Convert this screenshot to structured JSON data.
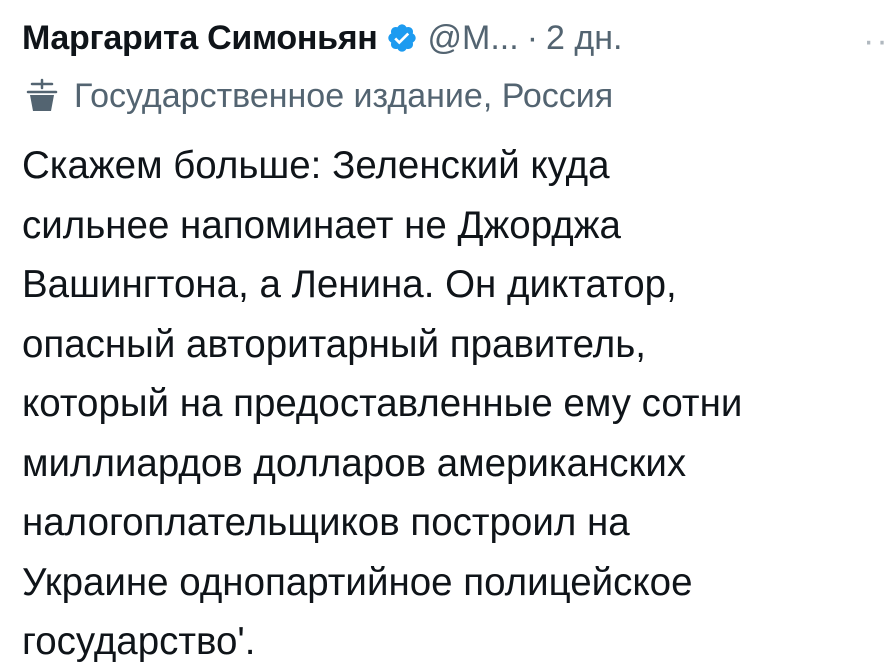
{
  "tweet": {
    "author": {
      "display_name": "Маргарита Симоньян",
      "verified_icon": "verified-badge-icon",
      "handle": "@М...",
      "separator": "·",
      "timestamp": "2 дн."
    },
    "more_icon": "more-options-icon",
    "more_glyph": "···",
    "label": {
      "icon": "state-media-icon",
      "text": "Государственное издание, Россия"
    },
    "body_lines": [
      "Скажем больше: Зеленский куда",
      "сильнее напоминает не Джорджа",
      "Вашингтона, а Ленина. Он диктатор,",
      "опасный авторитарный правитель,",
      "который на предоставленные ему сотни",
      "миллиардов долларов американских",
      "налогоплательщиков построил на",
      "Украине однопартийное полицейское",
      "государство'."
    ]
  },
  "colors": {
    "text_primary": "#0f1419",
    "text_secondary": "#536471",
    "verified_blue": "#1d9bf0",
    "background": "#ffffff"
  }
}
